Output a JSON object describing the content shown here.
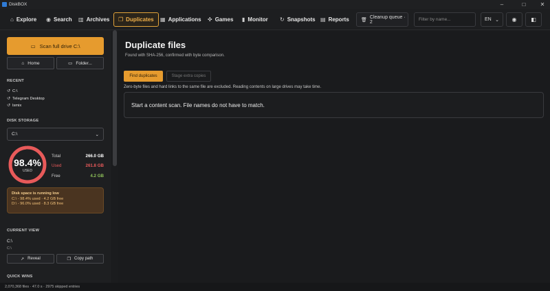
{
  "window": {
    "title": "DiskBOX",
    "minimize": "–",
    "maximize": "□",
    "close": "✕"
  },
  "nav": {
    "tabs": [
      {
        "label": "Explore",
        "icon": "⌂"
      },
      {
        "label": "Search",
        "icon": "◉"
      },
      {
        "label": "Archives",
        "icon": "▥"
      },
      {
        "label": "Duplicates",
        "icon": "❐"
      },
      {
        "label": "Applications",
        "icon": "▦"
      },
      {
        "label": "Games",
        "icon": "✜"
      },
      {
        "label": "Monitor",
        "icon": "▮"
      },
      {
        "label": "Snapshots",
        "icon": "↻"
      },
      {
        "label": "Reports",
        "icon": "▤"
      }
    ],
    "active_tab": "Duplicates",
    "cleanup_queue": "Cleanup queue · 2",
    "filter_placeholder": "Filter by name...",
    "language": "EN"
  },
  "sidebar": {
    "scan_button": "Scan full drive  C:\\",
    "home_button": "Home",
    "folder_button": "Folder...",
    "recent_heading": "RECENT",
    "recent_items": [
      "C:\\",
      "Telegram Desktop",
      "lsmix"
    ],
    "disk_storage_heading": "DISK STORAGE",
    "drive_selected": "C:\\",
    "gauge_percent": "98.4%",
    "gauge_used_fraction": 0.984,
    "gauge_caption": "USED",
    "stats": {
      "total_label": "Total",
      "total_value": "266.0 GB",
      "used_label": "Used",
      "used_value": "261.8 GB",
      "free_label": "Free",
      "free_value": "4.2 GB"
    },
    "warning": {
      "title": "Disk space is running low",
      "line1": "C:\\ - 98.4% used · 4.2 GB free",
      "line2": "D:\\ - 96.0% used · 8.3 GB free"
    },
    "current_view_heading": "CURRENT VIEW",
    "current_path": "C:\\",
    "current_path_sub": "C:\\",
    "reveal_button": "Reveal",
    "copy_path_button": "Copy path",
    "quick_wins_heading": "QUICK WINS"
  },
  "main": {
    "title": "Duplicate files",
    "subtitle": "Found with SHA-256, confirmed with byte comparison.",
    "find_button": "Find duplicates",
    "stage_button": "Stage extra copies",
    "note": "Zero-byte files and hard links to the same file are excluded. Reading contents on large drives may take time.",
    "panel_message": "Start a content scan. File names do not have to match."
  },
  "status": {
    "text": "2,070,368 files · 47.0 s · 2975 skipped entries"
  },
  "colors": {
    "accent": "#e69b2e",
    "used": "#e85a5a",
    "free": "#8fc25a",
    "warning_bg": "#4a3420"
  }
}
